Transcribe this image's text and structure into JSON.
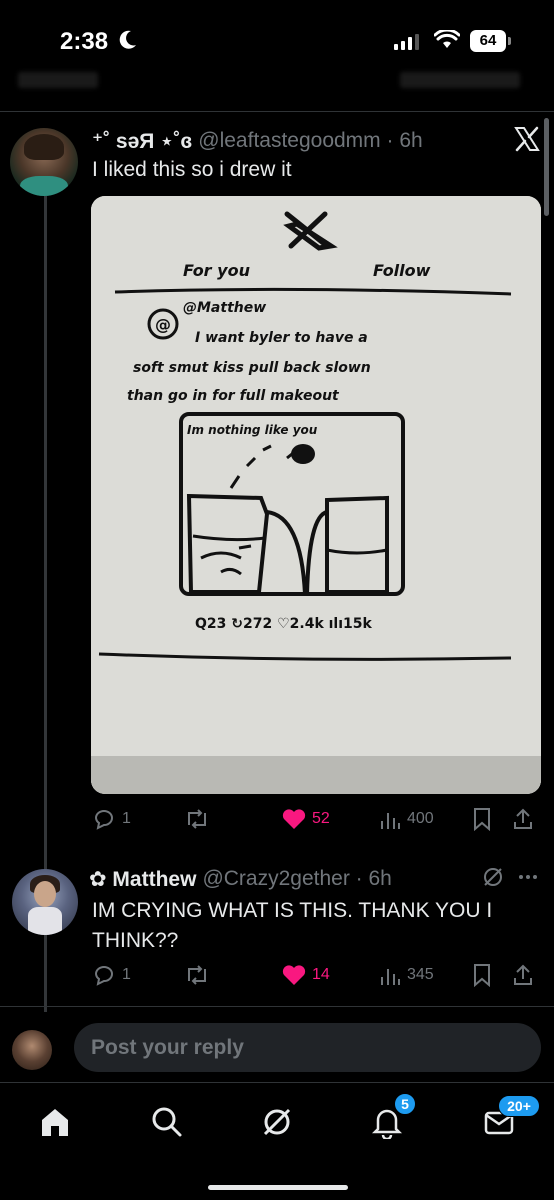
{
  "status_bar": {
    "time": "2:38",
    "battery": "64"
  },
  "tweet": {
    "display_name": "⁺˚ səЯ ⋆˚ɞ",
    "handle_time": "@leaftastegoodmm · 6h",
    "text": "I liked this so i drew it",
    "media": {
      "tabs": [
        "For you",
        "Follow"
      ],
      "quoted_user": "@Matthew",
      "quoted_text": [
        "I want byler to have a",
        "soft smut kiss pull back slown",
        "than go in for full makeout"
      ],
      "quoted_media_caption": "Im nothing like you",
      "quoted_stats": "Q23 ↻272 ♡2.4k ılı15k"
    },
    "actions": {
      "replies": "1",
      "likes": "52",
      "views": "400"
    },
    "icons": {
      "reply": "reply-icon",
      "repost": "repost-icon",
      "like": "heart-icon",
      "views": "views-icon",
      "bookmark": "bookmark-icon",
      "share": "share-icon",
      "platform": "x-logo-icon"
    }
  },
  "reply": {
    "display_name": "✿ Matthew",
    "handle_time": "@Crazy2gether · 6h",
    "text": "IM CRYING WHAT IS THIS. THANK YOU I THINK??",
    "actions": {
      "replies": "1",
      "likes": "14",
      "views": "345"
    }
  },
  "compose": {
    "placeholder": "Post your reply"
  },
  "tab_bar": {
    "notifications_badge": "5",
    "messages_badge": "20+"
  },
  "colors": {
    "background": "#000000",
    "text": "#e7e9ea",
    "muted": "#71767b",
    "like": "#f91880",
    "accent": "#1d9bf0"
  }
}
